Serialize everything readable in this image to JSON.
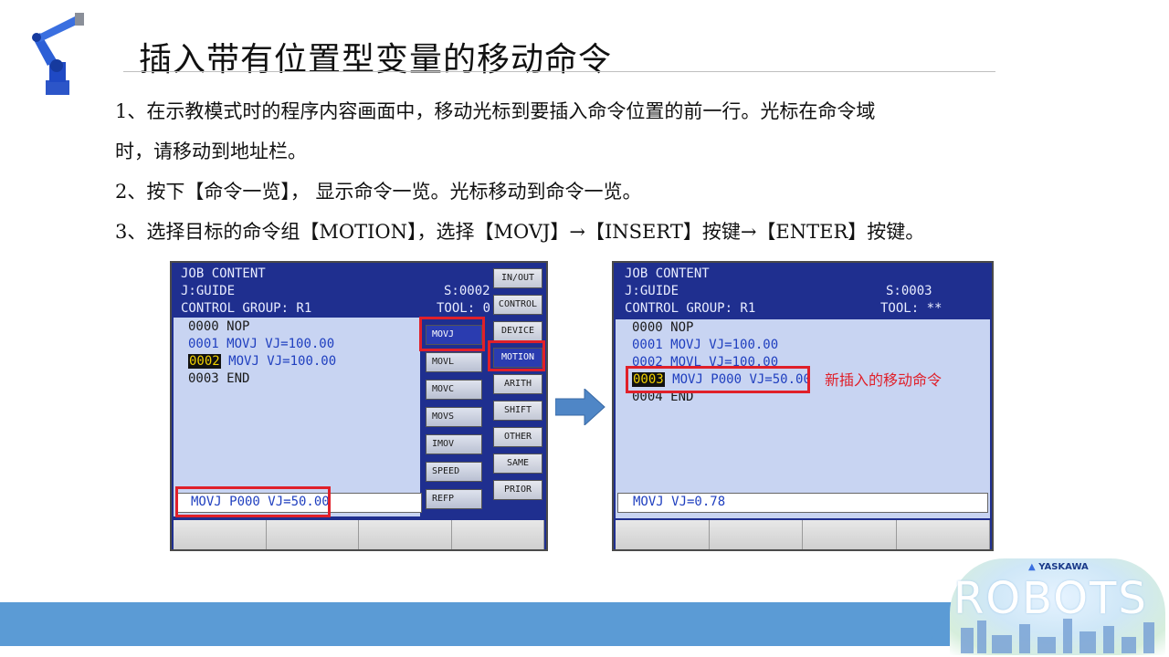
{
  "slide": {
    "title": "插入带有位置型变量的移动命令",
    "paragraphs": [
      "1、在示教模式时的程序内容画面中，移动光标到要插入命令位置的前一行。光标在命令域",
      "时，请移动到地址栏。",
      "2、按下【命令一览】，  显示命令一览。光标移动到命令一览。",
      "3、选择目标的命令组【MOTION】，选择【MOVJ】→【INSERT】按键→【ENTER】按键。"
    ]
  },
  "left_screen": {
    "header": {
      "line1": "JOB CONTENT",
      "line2_left": "J:GUIDE",
      "line2_right": "S:0002",
      "line3_left": "CONTROL GROUP: R1",
      "line3_right": "TOOL: 0"
    },
    "job_lines": [
      {
        "num": "0000",
        "text": "NOP"
      },
      {
        "num": "0001",
        "text": "MOVJ VJ=100.00"
      },
      {
        "num": "0002",
        "text": "MOVJ VJ=100.00"
      },
      {
        "num": "0003",
        "text": "END"
      }
    ],
    "input_value": "MOVJ P000 VJ=50.00",
    "commands": [
      "MOVJ",
      "MOVL",
      "MOVC",
      "MOVS",
      "IMOV",
      "SPEED",
      "REFP"
    ],
    "groups": [
      "IN/OUT",
      "CONTROL",
      "DEVICE",
      "MOTION",
      "ARITH",
      "SHIFT",
      "OTHER",
      "SAME",
      "PRIOR"
    ]
  },
  "right_screen": {
    "header": {
      "line1": "JOB CONTENT",
      "line2_left": "J:GUIDE",
      "line2_right": "S:0003",
      "line3_left": "CONTROL GROUP: R1",
      "line3_right": "TOOL: **"
    },
    "job_lines": [
      {
        "num": "0000",
        "text": "NOP"
      },
      {
        "num": "0001",
        "text": "MOVJ VJ=100.00"
      },
      {
        "num": "0002",
        "text": "MOVL VJ=100.00"
      },
      {
        "num": "0003",
        "text": "MOVJ P000 VJ=50.00"
      },
      {
        "num": "0004",
        "text": "END"
      }
    ],
    "input_value": "MOVJ VJ=0.78",
    "annotation": "新插入的移动命令"
  },
  "brand": {
    "company": "YASKAWA",
    "word": "ROBOTS"
  },
  "colors": {
    "screen_blue": "#1f2f8f",
    "screen_body": "#c8d4f2",
    "highlight_red": "#e0202a",
    "band_blue": "#5b9bd5",
    "arrow_blue": "#4f86c6"
  }
}
